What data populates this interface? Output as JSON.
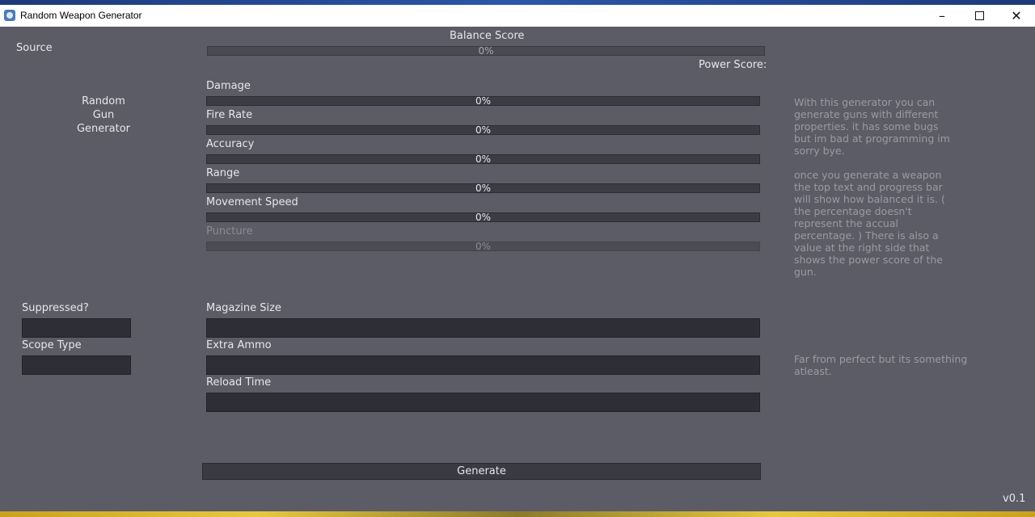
{
  "window": {
    "title": "Random Weapon Generator",
    "minimize": "–",
    "close": "✕"
  },
  "header": {
    "source_label": "Source",
    "balance_label": "Balance Score",
    "balance_pct": "0%",
    "power_label": "Power Score:"
  },
  "side_title": [
    "Random",
    "Gun",
    "Generator"
  ],
  "stats": [
    {
      "label": "Damage",
      "pct": "0%"
    },
    {
      "label": "Fire Rate",
      "pct": "0%"
    },
    {
      "label": "Accuracy",
      "pct": "0%"
    },
    {
      "label": "Range",
      "pct": "0%"
    },
    {
      "label": "Movement Speed",
      "pct": "0%"
    },
    {
      "label": "Puncture",
      "pct": "0%"
    }
  ],
  "left_fields": {
    "suppressed_label": "Suppressed?",
    "scope_label": "Scope Type"
  },
  "mid_fields": {
    "magazine_label": "Magazine Size",
    "extra_ammo_label": "Extra Ammo",
    "reload_label": "Reload Time"
  },
  "info": {
    "paragraph1": "With this generator you can\ngenerate guns with different\nproperties. it has some bugs\nbut im bad at programming im\nsorry bye.",
    "paragraph2": "once you generate a weapon\nthe top text and progress bar\nwill show how balanced it is. (\nthe percentage doesn't\nrepresent the accual\npercentage. ) There is also a\nvalue at the right side that\nshows the power score of the\ngun.",
    "paragraph3": "Far from perfect but its something\natleast."
  },
  "generate_label": "Generate",
  "version": "v0.1",
  "colors": {
    "background": "#5c5c66",
    "field": "#2e2e36",
    "bar": "#3c3c44",
    "text": "#e6e6ea",
    "muted": "#9a9aa2"
  }
}
